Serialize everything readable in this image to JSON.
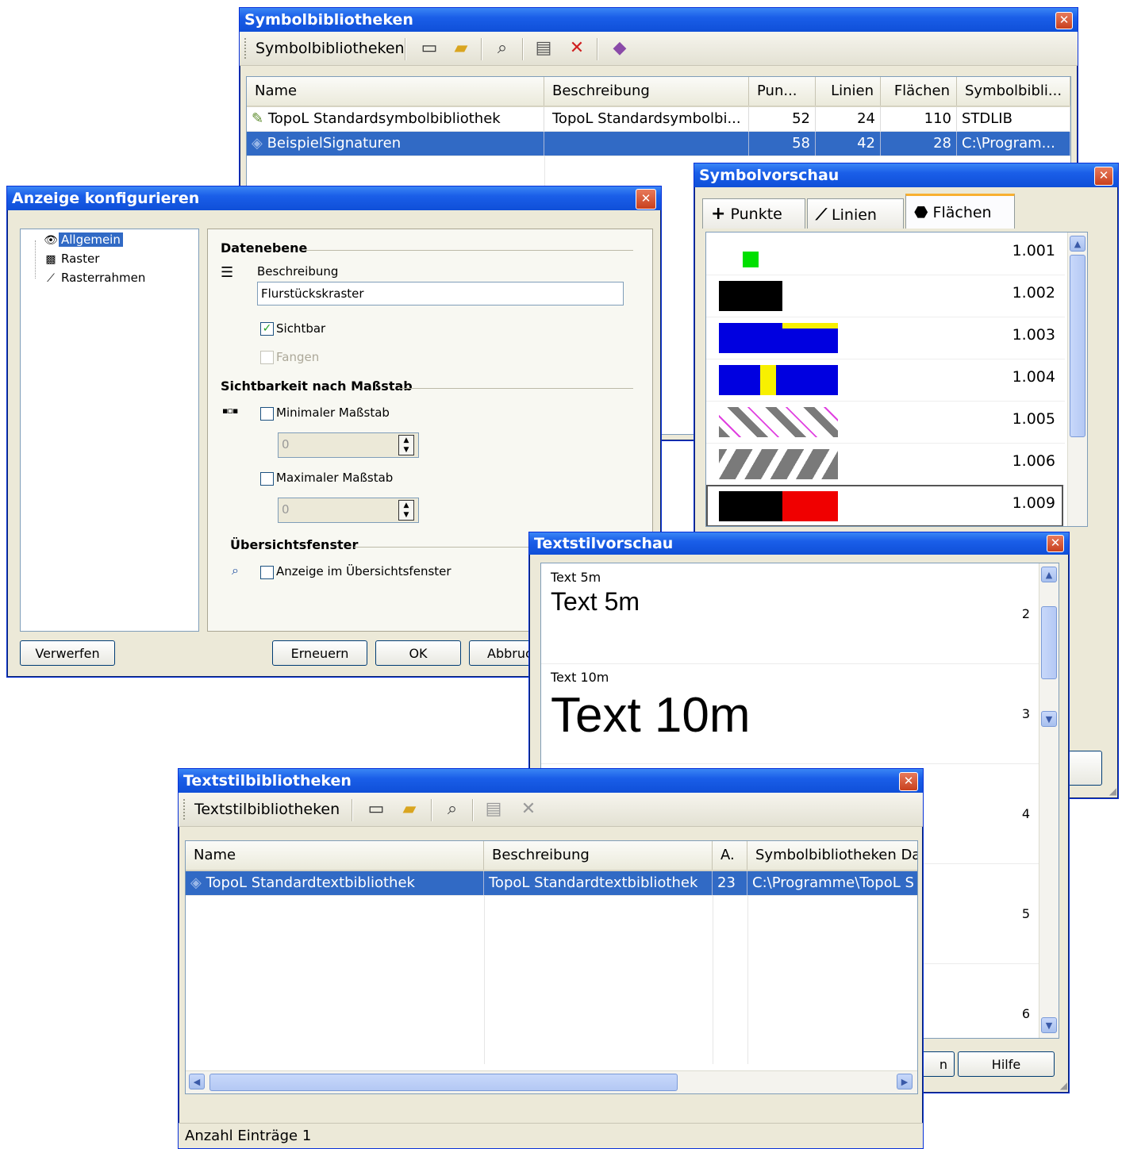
{
  "symbolbib": {
    "title": "Symbolbibliotheken",
    "toolbar_label": "Symbolbibliotheken",
    "columns": [
      "Name",
      "Beschreibung",
      "Pun...",
      "Linien",
      "Flächen",
      "Symbolbibli..."
    ],
    "rows": [
      {
        "name": "TopoL Standardsymbolbibliothek",
        "desc": "TopoL Standardsymbolbi...",
        "pun": "52",
        "linien": "24",
        "flaechen": "110",
        "lib": "STDLIB"
      },
      {
        "name": "BeispielSignaturen",
        "desc": "",
        "pun": "58",
        "linien": "42",
        "flaechen": "28",
        "lib": "C:\\Program..."
      }
    ]
  },
  "anzeige": {
    "title": "Anzeige konfigurieren",
    "tree": [
      "Allgemein",
      "Raster",
      "Rasterrahmen"
    ],
    "section_datenebene": "Datenebene",
    "beschreibung_label": "Beschreibung",
    "beschreibung_value": "Flurstückskraster",
    "sichtbar_label": "Sichtbar",
    "fangen_label": "Fangen",
    "section_sichtbarkeit": "Sichtbarkeit nach Maßstab",
    "minimal_label": "Minimaler Maßstab",
    "minimal_value": "0",
    "maximal_label": "Maximaler Maßstab",
    "maximal_value": "0",
    "section_uebersicht": "Übersichtsfenster",
    "uebersicht_label": "Anzeige im Übersichtsfenster",
    "btn_verwerfen": "Verwerfen",
    "btn_erneuern": "Erneuern",
    "btn_ok": "OK",
    "btn_abbruch": "Abbruc"
  },
  "symbolvorschau": {
    "title": "Symbolvorschau",
    "tabs": [
      "Punkte",
      "Linien",
      "Flächen"
    ],
    "items": [
      "1.001",
      "1.002",
      "1.003",
      "1.004",
      "1.005",
      "1.006",
      "1.009"
    ],
    "colors": {
      "green": "#00e000",
      "blue": "#0000e0",
      "yellow": "#f8f000",
      "red": "#f00000",
      "gray": "#7a7a7a",
      "magenta": "#e040e0"
    }
  },
  "textstilvorschau": {
    "title": "Textstilvorschau",
    "rows": [
      {
        "small": "Text 5m",
        "large": "Text 5m",
        "idx": "2"
      },
      {
        "small": "Text 10m",
        "large": "Text 10m",
        "idx": "3"
      },
      {
        "small": "",
        "large": "",
        "idx": "4"
      },
      {
        "small": "",
        "large": "",
        "idx": "5"
      },
      {
        "small": "",
        "large": "",
        "idx": "6"
      }
    ],
    "btn_n": "n",
    "btn_hilfe": "Hilfe"
  },
  "textstilbib": {
    "title": "Textstilbibliotheken",
    "toolbar_label": "Textstilbibliotheken",
    "columns": [
      "Name",
      "Beschreibung",
      "A.",
      "Symbolbibliotheken Da"
    ],
    "rows": [
      {
        "name": "TopoL Standardtextbibliothek",
        "desc": "TopoL Standardtextbibliothek",
        "a": "23",
        "path": "C:\\Programme\\TopoL S"
      }
    ],
    "status": "Anzahl Einträge 1"
  }
}
